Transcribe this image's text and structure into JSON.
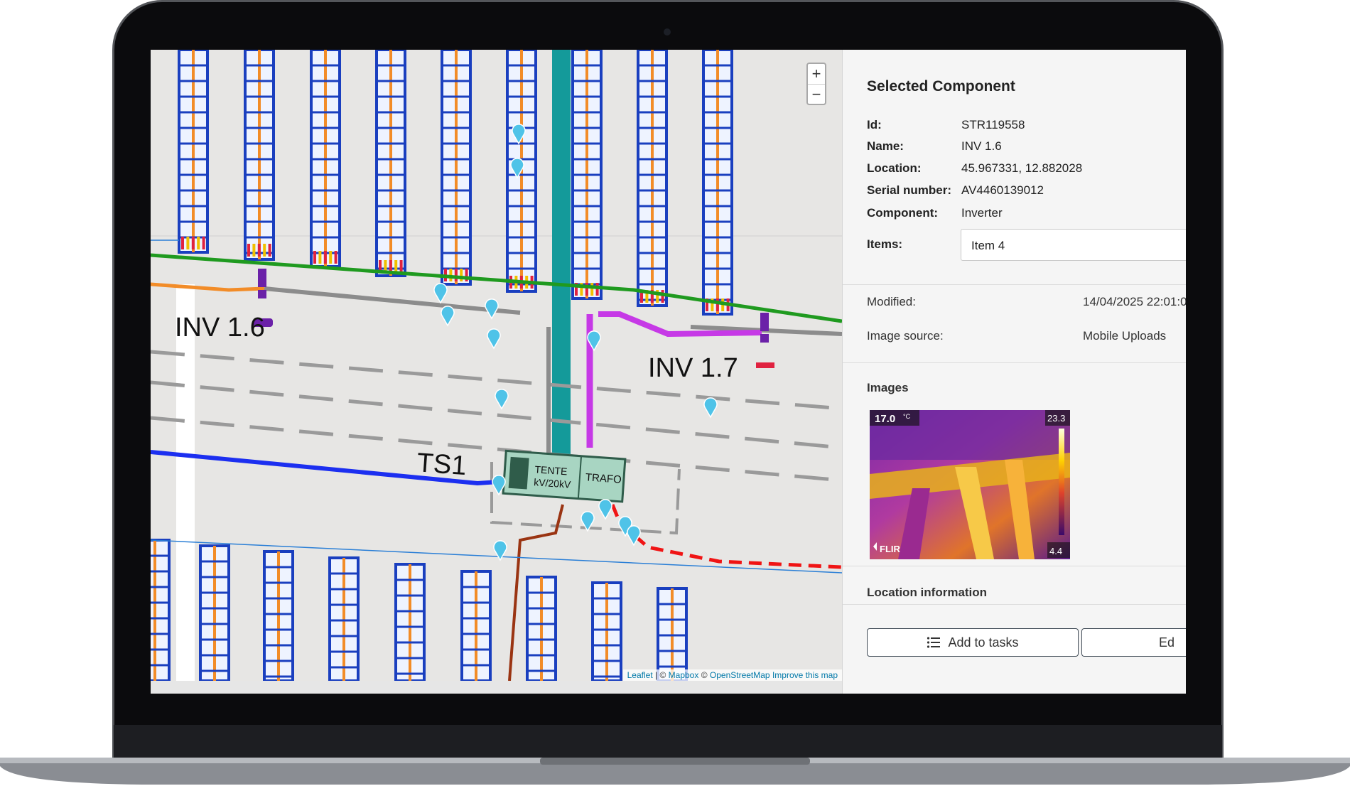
{
  "map": {
    "labels": {
      "inv16": "INV 1.6",
      "inv17": "INV 1.7",
      "ts1": "TS1"
    },
    "substation": {
      "line1": "TENTE",
      "line2": "kV/20kV",
      "trafo": "TRAFO"
    },
    "zoom": {
      "in": "+",
      "out": "−"
    },
    "attribution": {
      "leaflet": "Leaflet",
      "sep": "|",
      "copy1": "©",
      "mapbox": "Mapbox",
      "copy2": "©",
      "osm": "OpenStreetMap",
      "improve": "Improve this map"
    }
  },
  "panel": {
    "title": "Selected Component",
    "fields": {
      "id": {
        "label": "Id:",
        "value": "STR119558"
      },
      "name": {
        "label": "Name:",
        "value": "INV 1.6"
      },
      "location": {
        "label": "Location:",
        "value": "45.967331, 12.882028"
      },
      "serial": {
        "label": "Serial number:",
        "value": "AV4460139012"
      },
      "component": {
        "label": "Component:",
        "value": "Inverter"
      },
      "items": {
        "label": "Items:",
        "value": "Item 4"
      }
    },
    "modified": {
      "label": "Modified:",
      "value": "14/04/2025 22:01:0"
    },
    "image_source": {
      "label": "Image source:",
      "value": "Mobile Uploads"
    },
    "images_title": "Images",
    "thermal": {
      "temp_spot": "17.0",
      "unit": "°C",
      "max": "23.3",
      "min": "4.4",
      "brand": "FLIR"
    },
    "location_info_title": "Location information",
    "buttons": {
      "add_tasks": "Add to tasks",
      "edit": "Ed"
    }
  },
  "colors": {
    "string_frame": "#1a3fbf",
    "string_core": "#f28c28",
    "green_cable": "#1f9a1f",
    "purple_cable": "#c639e6",
    "teal_road": "#149a9a",
    "marker": "#4fc3e8"
  }
}
